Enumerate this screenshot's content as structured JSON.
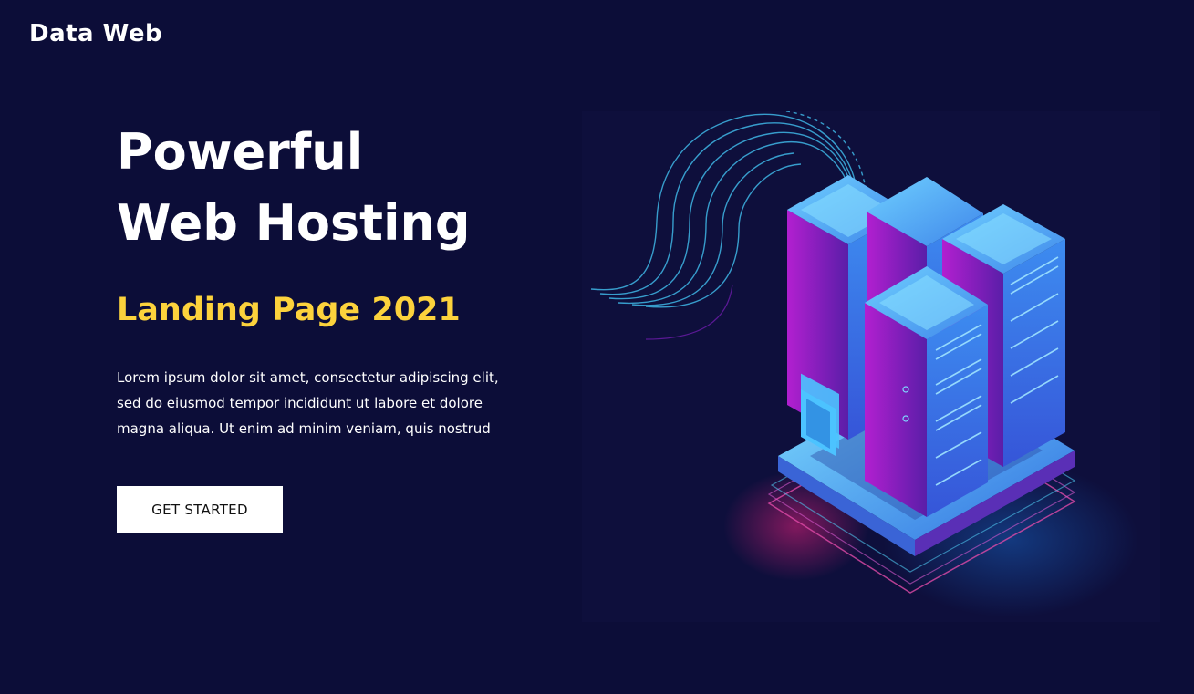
{
  "header": {
    "logo_text": "Data Web"
  },
  "hero": {
    "headline_line1": "Powerful",
    "headline_line2": "Web Hosting",
    "subheadline": "Landing Page 2021",
    "body_line1": "Lorem ipsum dolor sit amet, consectetur adipiscing elit,",
    "body_line2": "sed do eiusmod tempor incididunt ut labore et dolore",
    "body_line3": "magna aliqua. Ut enim ad minim veniam, quis nostrud",
    "cta_label": "GET STARTED"
  },
  "colors": {
    "background": "#0c0d38",
    "accent_yellow": "#fcd23c",
    "button_bg": "#ffffff",
    "server_blue": "#4aa7f0",
    "server_purple": "#7a1fb8"
  },
  "illustration": {
    "icon": "isometric-server-rack-illustration"
  }
}
